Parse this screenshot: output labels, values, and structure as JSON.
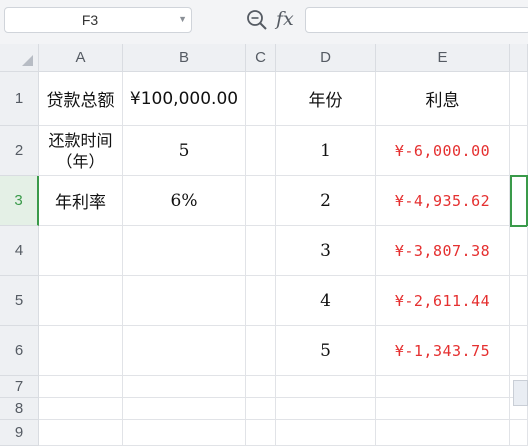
{
  "toolbar": {
    "namebox_value": "F3",
    "fx_label": "fx",
    "formula_value": ""
  },
  "columns": [
    "A",
    "B",
    "C",
    "D",
    "E"
  ],
  "rows": [
    "1",
    "2",
    "3",
    "4",
    "5",
    "6",
    "7",
    "8",
    "9"
  ],
  "active_row": "3",
  "active_cell": "F3",
  "cells": {
    "A1": "贷款总额",
    "B1": "¥100,000.00",
    "D1": "年份",
    "E1": "利息",
    "A2": "还款时间\n（年）",
    "B2": "5",
    "D2": "1",
    "E2": "¥-6,000.00",
    "A3": "年利率",
    "B3": "6%",
    "D3": "2",
    "E3": "¥-4,935.62",
    "D4": "3",
    "E4": "¥-3,807.38",
    "D5": "4",
    "E5": "¥-2,611.44",
    "D6": "5",
    "E6": "¥-1,343.75"
  },
  "colors": {
    "money_text": "#e53030",
    "selection": "#3a9a4a"
  }
}
